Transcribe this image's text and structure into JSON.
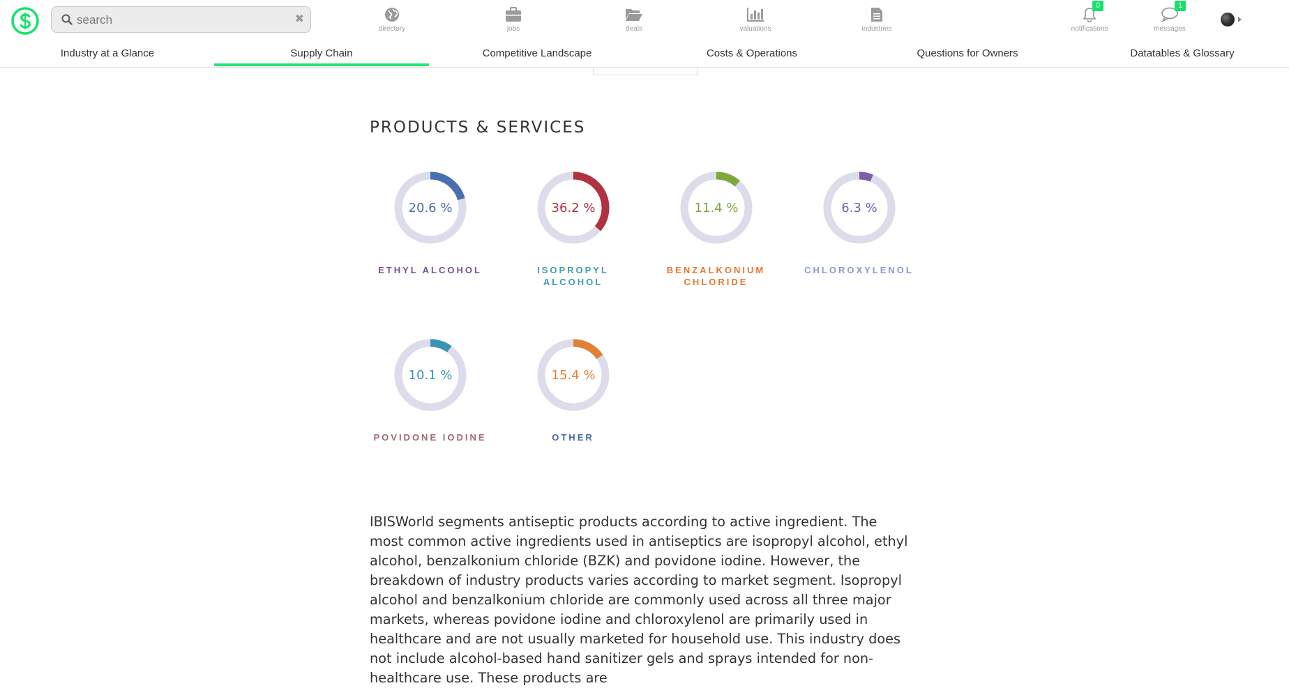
{
  "app": {
    "search": {
      "placeholder": "search",
      "value": ""
    },
    "nav": [
      {
        "label": "directory",
        "icon": "globe-icon"
      },
      {
        "label": "jobs",
        "icon": "briefcase-icon"
      },
      {
        "label": "deals",
        "icon": "folder-open-icon"
      },
      {
        "label": "valuations",
        "icon": "bar-chart-icon"
      },
      {
        "label": "industries",
        "icon": "document-icon"
      }
    ],
    "notifications": {
      "label": "notifications",
      "count": "0",
      "icon": "bell-icon"
    },
    "messages": {
      "label": "messages",
      "count": "1",
      "icon": "chat-icon"
    },
    "brand_color": "#14e36a"
  },
  "tabs": [
    {
      "label": "Industry at a Glance",
      "active": false
    },
    {
      "label": "Supply Chain",
      "active": true
    },
    {
      "label": "Competitive Landscape",
      "active": false
    },
    {
      "label": "Costs & Operations",
      "active": false
    },
    {
      "label": "Questions for Owners",
      "active": false
    },
    {
      "label": "Datatables & Glossary",
      "active": false
    }
  ],
  "section": {
    "title": "PRODUCTS & SERVICES",
    "products": [
      {
        "name": "ETHYL ALCOHOL",
        "value": 20.6,
        "pct_label": "20.6 %",
        "arc_color": "#4a6fb1",
        "label_color": "#7b4e93"
      },
      {
        "name": "ISOPROPYL ALCOHOL",
        "value": 36.2,
        "pct_label": "36.2 %",
        "arc_color": "#b0313f",
        "label_color": "#3f9cb5"
      },
      {
        "name": "BENZALKONIUM CHLORIDE",
        "value": 11.4,
        "pct_label": "11.4 %",
        "arc_color": "#7ea83d",
        "label_color": "#e3782f"
      },
      {
        "name": "CHLOROXYLENOL",
        "value": 6.3,
        "pct_label": "6.3 %",
        "arc_color": "#7b5ea7",
        "label_color": "#8a9ad1"
      },
      {
        "name": "POVIDONE IODINE",
        "value": 10.1,
        "pct_label": "10.1 %",
        "arc_color": "#3a93b3",
        "label_color": "#a06a6e"
      },
      {
        "name": "OTHER",
        "value": 15.4,
        "pct_label": "15.4 %",
        "arc_color": "#e08236",
        "label_color": "#4569ad"
      }
    ],
    "track_color": "#dcdcea",
    "body": "IBISWorld segments antiseptic products according to active ingredient. The most common active ingredients used in antiseptics are isopropyl alcohol, ethyl alcohol, benzalkonium chloride (BZK) and povidone iodine. However, the breakdown of industry products varies according to market segment. Isopropyl alcohol and benzalkonium chloride are commonly used across all three major markets, whereas povidone iodine and chloroxylenol are primarily used in healthcare and are not usually marketed for household use. This industry does not include alcohol-based hand sanitizer gels and sprays intended for non-healthcare use. These products are"
  }
}
